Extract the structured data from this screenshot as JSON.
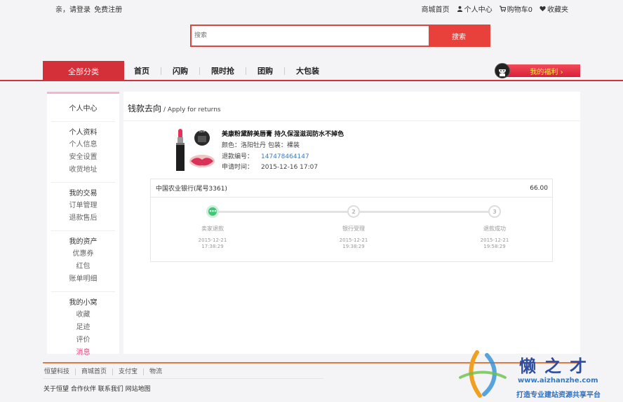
{
  "topbar": {
    "greeting": "亲，请登录",
    "register": "免费注册",
    "links": {
      "home": "商城首页",
      "user_center": "个人中心",
      "cart": "购物车0",
      "favorites": "收藏夹"
    }
  },
  "search": {
    "placeholder": "搜索",
    "button": "搜索"
  },
  "nav": {
    "all_categories": "全部分类",
    "links": [
      "首页",
      "闪购",
      "限时抢",
      "团购",
      "大包装"
    ],
    "welfare": "我的福利 ›"
  },
  "sidebar": {
    "title": "个人中心",
    "groups": [
      {
        "heading": "个人资料",
        "items": [
          "个人信息",
          "安全设置",
          "收货地址"
        ]
      },
      {
        "heading": "我的交易",
        "items": [
          "订单管理",
          "退款售后"
        ]
      },
      {
        "heading": "我的资产",
        "items": [
          "优惠券",
          "红包",
          "账单明细"
        ]
      },
      {
        "heading": "我的小窝",
        "items": [
          "收藏",
          "足迹",
          "评价",
          "消息"
        ]
      }
    ]
  },
  "main": {
    "title": "钱款去向",
    "subtitle": "/ Apply for returns",
    "product": {
      "name": "美康粉黛醉美唇膏 持久保湿滋润防水不掉色",
      "spec": "颜色：洛阳牡丹 包装：裸装",
      "refund_no_label": "退款编号：",
      "refund_no": "147478464147",
      "apply_time_label": "申请时间：",
      "apply_time": "2015-12-16 17:07",
      "image_badge": "02#"
    },
    "refund": {
      "bank": "中国农业银行(尾号3361)",
      "amount": "66.00",
      "steps": [
        {
          "icon": "•••",
          "label": "卖家退款",
          "date": "2015-12-21",
          "time": "17:38:29",
          "done": true
        },
        {
          "icon": "2",
          "label": "银行受理",
          "date": "2015-12-21",
          "time": "19:38:29",
          "done": false
        },
        {
          "icon": "3",
          "label": "退款成功",
          "date": "2015-12-21",
          "time": "19:58:29",
          "done": false
        }
      ]
    }
  },
  "footer": {
    "links": [
      "恒望科技",
      "商城首页",
      "支付宝",
      "物流"
    ],
    "bottom": "关于恒望 合作伙伴 联系我们 网站地图"
  },
  "watermark": {
    "brand": "懒之才",
    "url": "www.aizhanzhe.com",
    "slogan": "打造专业建站资源共享平台"
  },
  "colors": {
    "accent_red": "#d4303a",
    "search_red": "#e8403a",
    "link_blue": "#3a7cc8",
    "success_green": "#3ec873",
    "active_pink": "#e0457a"
  }
}
